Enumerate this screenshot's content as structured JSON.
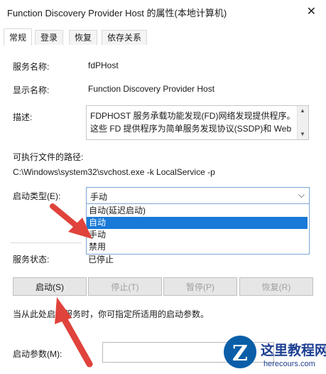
{
  "window": {
    "title": "Function Discovery Provider Host 的属性(本地计算机)",
    "close_symbol": "✕"
  },
  "tabs": [
    "常规",
    "登录",
    "恢复",
    "依存关系"
  ],
  "fields": {
    "service_name_label": "服务名称:",
    "service_name": "fdPHost",
    "display_name_label": "显示名称:",
    "display_name": "Function Discovery Provider Host",
    "description_label": "描述:",
    "description_line1": "FDPHOST 服务承载功能发现(FD)网络发现提供程序。",
    "description_line2": "这些 FD 提供程序为简单服务发现协议(SSDP)和 Web",
    "exe_path_label": "可执行文件的路径:",
    "exe_path": "C:\\Windows\\system32\\svchost.exe -k LocalService -p",
    "startup_type_label": "启动类型(E):",
    "startup_type_value": "手动"
  },
  "dropdown": {
    "options": [
      "自动(延迟启动)",
      "自动",
      "手动",
      "禁用"
    ],
    "highlighted": "自动"
  },
  "status": {
    "label": "服务状态:",
    "value": "已停止"
  },
  "buttons": {
    "start": "启动(S)",
    "stop": "停止(T)",
    "pause": "暂停(P)",
    "resume": "恢复(R)"
  },
  "hint": "当从此处启动服务时，你可指定所适用的启动参数。",
  "start_params_label": "启动参数(M):",
  "watermark": {
    "title": "这里教程网",
    "url": "herecours.com"
  },
  "colors": {
    "arrow": "#e0433b",
    "selection": "#1879d8",
    "focus_border": "#7aa7d6"
  }
}
